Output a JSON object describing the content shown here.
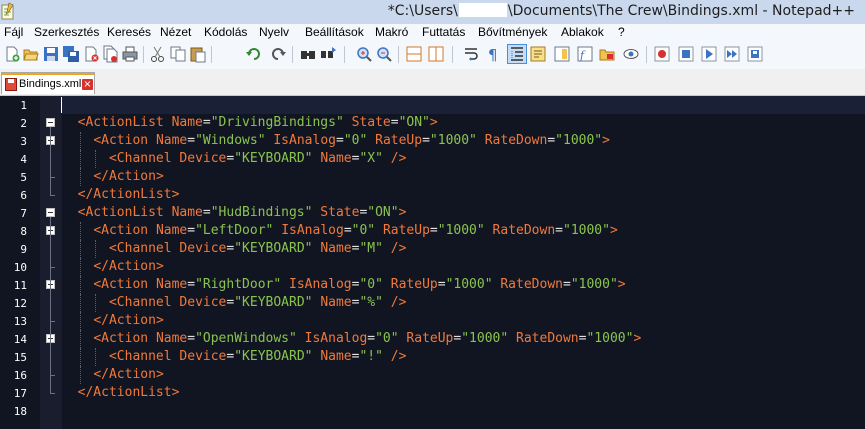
{
  "window": {
    "title_prefix": "*C:\\Users\\",
    "title_suffix": "\\Documents\\The Crew\\Bindings.xml - Notepad++"
  },
  "menu": [
    "Fájl",
    "Szerkesztés",
    "Keresés",
    "Nézet",
    "Kódolás",
    "Nyelv",
    "Beállítások",
    "Makró",
    "Futtatás",
    "Bővítmények",
    "Ablakok",
    "?"
  ],
  "tab": {
    "label": "Bindings.xml",
    "close": "×"
  },
  "toolbar": {
    "icons": [
      "new-file-icon",
      "open-file-icon",
      "save-icon",
      "save-all-icon",
      "close-icon",
      "close-all-icon",
      "print-icon",
      "cut-icon",
      "copy-icon",
      "paste-icon",
      "undo-icon",
      "redo-icon",
      "find-icon",
      "replace-icon",
      "zoom-in-icon",
      "zoom-out-icon",
      "sync-vertical-icon",
      "sync-horizontal-icon",
      "word-wrap-icon",
      "show-all-chars-icon",
      "indent-guide-icon",
      "udl-icon",
      "doc-map-icon",
      "function-list-icon",
      "folder-workspace-icon",
      "monitoring-icon",
      "record-macro-icon",
      "stop-record-icon",
      "playback-macro-icon",
      "run-macro-multiple-icon",
      "save-macro-icon"
    ],
    "active": "indent-guide-icon"
  },
  "colors": {
    "tag": "#f07a3a",
    "value": "#8ac44f",
    "background": "#111421"
  },
  "editor": {
    "line_numbers": [
      "1",
      "2",
      "3",
      "4",
      "5",
      "6",
      "7",
      "8",
      "9",
      "10",
      "11",
      "12",
      "13",
      "14",
      "15",
      "16",
      "17",
      "18"
    ],
    "lines": [
      "",
      "  <ActionList Name=\"DrivingBindings\" State=\"ON\">",
      "    <Action Name=\"Windows\" IsAnalog=\"0\" RateUp=\"1000\" RateDown=\"1000\">",
      "      <Channel Device=\"KEYBOARD\" Name=\"X\" />",
      "    </Action>",
      "  </ActionList>",
      "  <ActionList Name=\"HudBindings\" State=\"ON\">",
      "    <Action Name=\"LeftDoor\" IsAnalog=\"0\" RateUp=\"1000\" RateDown=\"1000\">",
      "      <Channel Device=\"KEYBOARD\" Name=\"M\" />",
      "    </Action>",
      "    <Action Name=\"RightDoor\" IsAnalog=\"0\" RateUp=\"1000\" RateDown=\"1000\">",
      "      <Channel Device=\"KEYBOARD\" Name=\"%\" />",
      "    </Action>",
      "    <Action Name=\"OpenWindows\" IsAnalog=\"0\" RateUp=\"1000\" RateDown=\"1000\">",
      "      <Channel Device=\"KEYBOARD\" Name=\"!\" />",
      "    </Action>",
      "  </ActionList>",
      ""
    ],
    "fold_lines": [
      2,
      3,
      7,
      8,
      11,
      14
    ]
  }
}
